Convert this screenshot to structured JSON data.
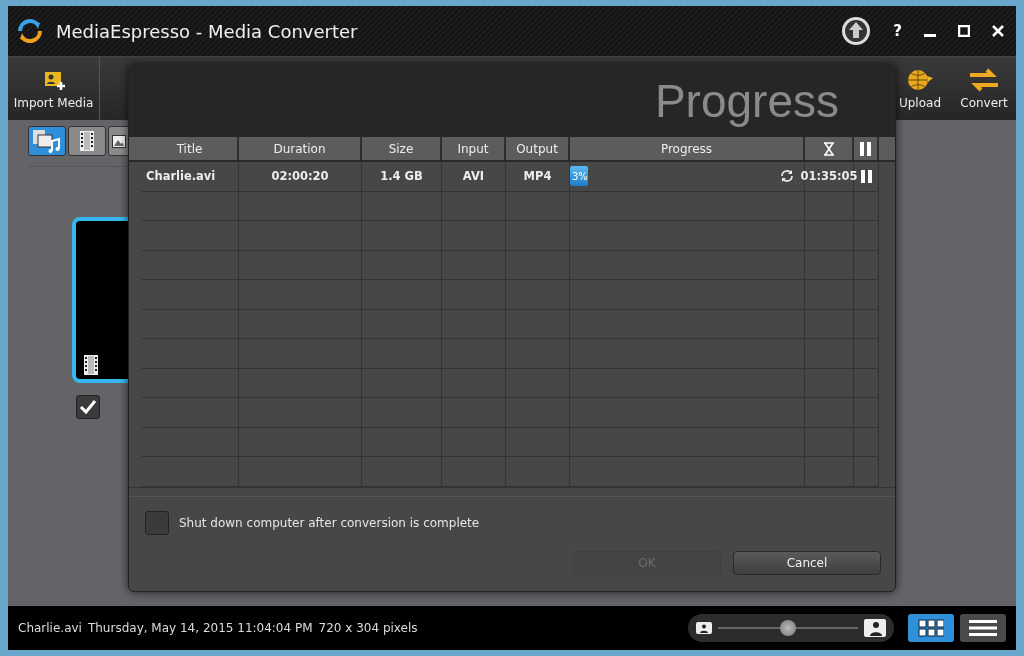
{
  "window": {
    "title": "MediaEspresso - Media Converter",
    "help": "?"
  },
  "toolbar": {
    "buttons": [
      {
        "kind": "import",
        "label": "Import Media"
      },
      {
        "kind": "upload",
        "label": "Upload"
      },
      {
        "kind": "convert",
        "label": "Convert"
      }
    ]
  },
  "media_tabs": [
    {
      "kind": "all",
      "selected": true
    },
    {
      "kind": "video",
      "selected": false
    },
    {
      "kind": "photo",
      "selected": false
    }
  ],
  "media_items": [
    {
      "kind": "video",
      "selected": true,
      "checked": true
    }
  ],
  "dialog": {
    "title": "Progress",
    "table": {
      "columns": [
        {
          "kind": "text",
          "label": "Title"
        },
        {
          "kind": "text",
          "label": "Duration"
        },
        {
          "kind": "text",
          "label": "Size"
        },
        {
          "kind": "text",
          "label": "Input"
        },
        {
          "kind": "text",
          "label": "Output"
        },
        {
          "kind": "text",
          "label": "Progress"
        },
        {
          "kind": "hourglass"
        },
        {
          "kind": "pause"
        }
      ],
      "rows": [
        {
          "title": "Charlie.avi",
          "duration": "02:00:20",
          "size": "1.4 GB",
          "input": "AVI",
          "output": "MP4",
          "level": 0.03,
          "progress_text": "3%",
          "remaining": "01:35:05"
        }
      ]
    },
    "shutdown": {
      "label": "Shut down computer after conversion is complete",
      "checked": false
    },
    "buttons": [
      {
        "label": "OK",
        "disabled": true
      },
      {
        "label": "Cancel",
        "disabled": false
      }
    ]
  },
  "status_bar": {
    "file": "Charlie.avi",
    "date": "Thursday, May 14, 2015 11:04:04 PM",
    "dimensions": "720 x 304 pixels",
    "zoom": {
      "level": 0.5
    },
    "views": [
      {
        "kind": "grid",
        "selected": true
      },
      {
        "kind": "list",
        "selected": false
      }
    ]
  }
}
